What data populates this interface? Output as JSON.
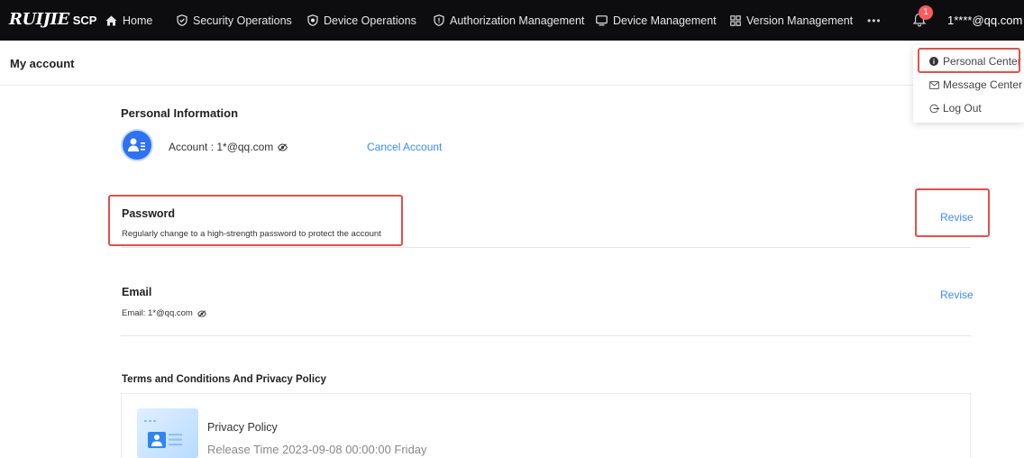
{
  "nav": {
    "logo": "RUIJIE",
    "logo_suffix": "SCP",
    "items": [
      {
        "label": "Home",
        "icon": "home-icon"
      },
      {
        "label": "Security Operations",
        "icon": "shield-check-icon"
      },
      {
        "label": "Device Operations",
        "icon": "shield-star-icon"
      },
      {
        "label": "Authorization Management",
        "icon": "shield-info-icon"
      },
      {
        "label": "Device Management",
        "icon": "monitor-icon"
      },
      {
        "label": "Version Management",
        "icon": "grid-icon"
      }
    ],
    "more": "•••",
    "notification_count": "1",
    "user": "1****@qq.com"
  },
  "subheader": {
    "title": "My account"
  },
  "dropdown": {
    "items": [
      {
        "label": "Personal Center",
        "icon": "info-circle-icon"
      },
      {
        "label": "Message Center",
        "icon": "mail-icon"
      },
      {
        "label": "Log Out",
        "icon": "logout-icon"
      }
    ]
  },
  "personal": {
    "title": "Personal Information",
    "account": "Account : 1*@qq.com",
    "cancel": "Cancel Account"
  },
  "password": {
    "title": "Password",
    "desc": "Regularly change to a high-strength password to protect the account",
    "action": "Revise"
  },
  "email": {
    "title": "Email",
    "value": "Email: 1*@qq.com",
    "action": "Revise"
  },
  "terms": {
    "title": "Terms and Conditions And Privacy Policy",
    "policy_name": "Privacy Policy",
    "release_time": "Release Time 2023-09-08 00:00:00 Friday"
  },
  "colors": {
    "topbar": "#0d0d0f",
    "link": "#3d8bfa",
    "highlight": "#e2504d",
    "avatar": "#2f72f0",
    "badge": "#ff5a5f"
  }
}
